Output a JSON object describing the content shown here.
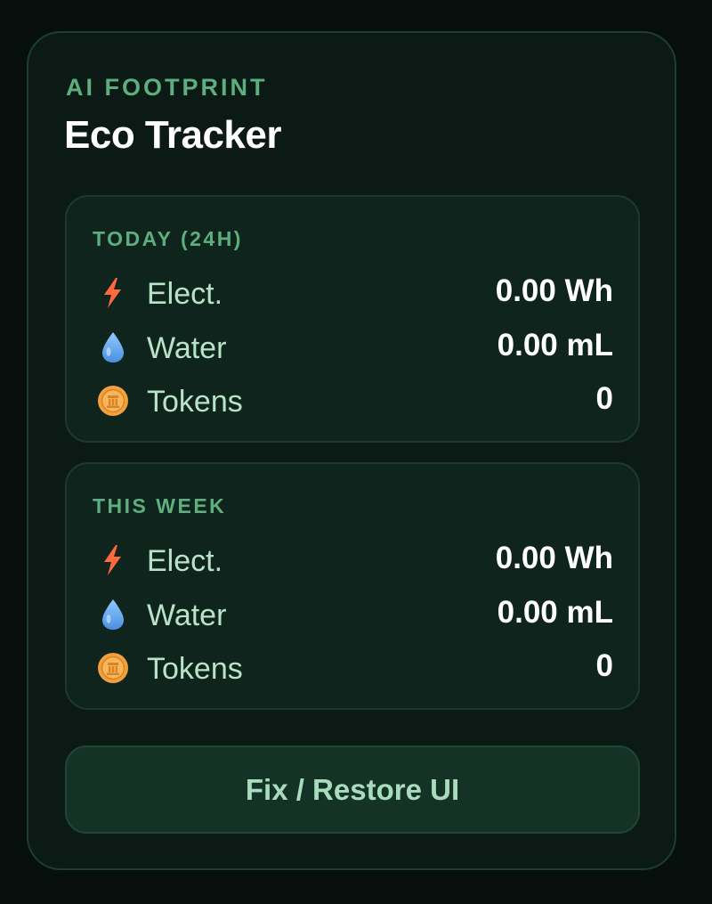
{
  "header": {
    "eyebrow": "AI FOOTPRINT",
    "title": "Eco Tracker"
  },
  "today": {
    "label": "TODAY (24H)",
    "rows": [
      {
        "icon": "lightning-icon",
        "label": "Elect.",
        "value": "0.00 Wh"
      },
      {
        "icon": "droplet-icon",
        "label": "Water",
        "value": "0.00 mL"
      },
      {
        "icon": "coin-icon",
        "label": "Tokens",
        "value": "0"
      }
    ]
  },
  "week": {
    "label": "THIS WEEK",
    "rows": [
      {
        "icon": "lightning-icon",
        "label": "Elect.",
        "value": "0.00 Wh"
      },
      {
        "icon": "droplet-icon",
        "label": "Water",
        "value": "0.00 mL"
      },
      {
        "icon": "coin-icon",
        "label": "Tokens",
        "value": "0"
      }
    ]
  },
  "actions": {
    "fix_label": "Fix / Restore UI"
  },
  "colors": {
    "background": "#060f0c",
    "panel": "#0b1a15",
    "accent": "#5fae7f",
    "lightning": "#ff6a3d",
    "water": "#6ab4f5",
    "coin": "#f2a13b"
  }
}
